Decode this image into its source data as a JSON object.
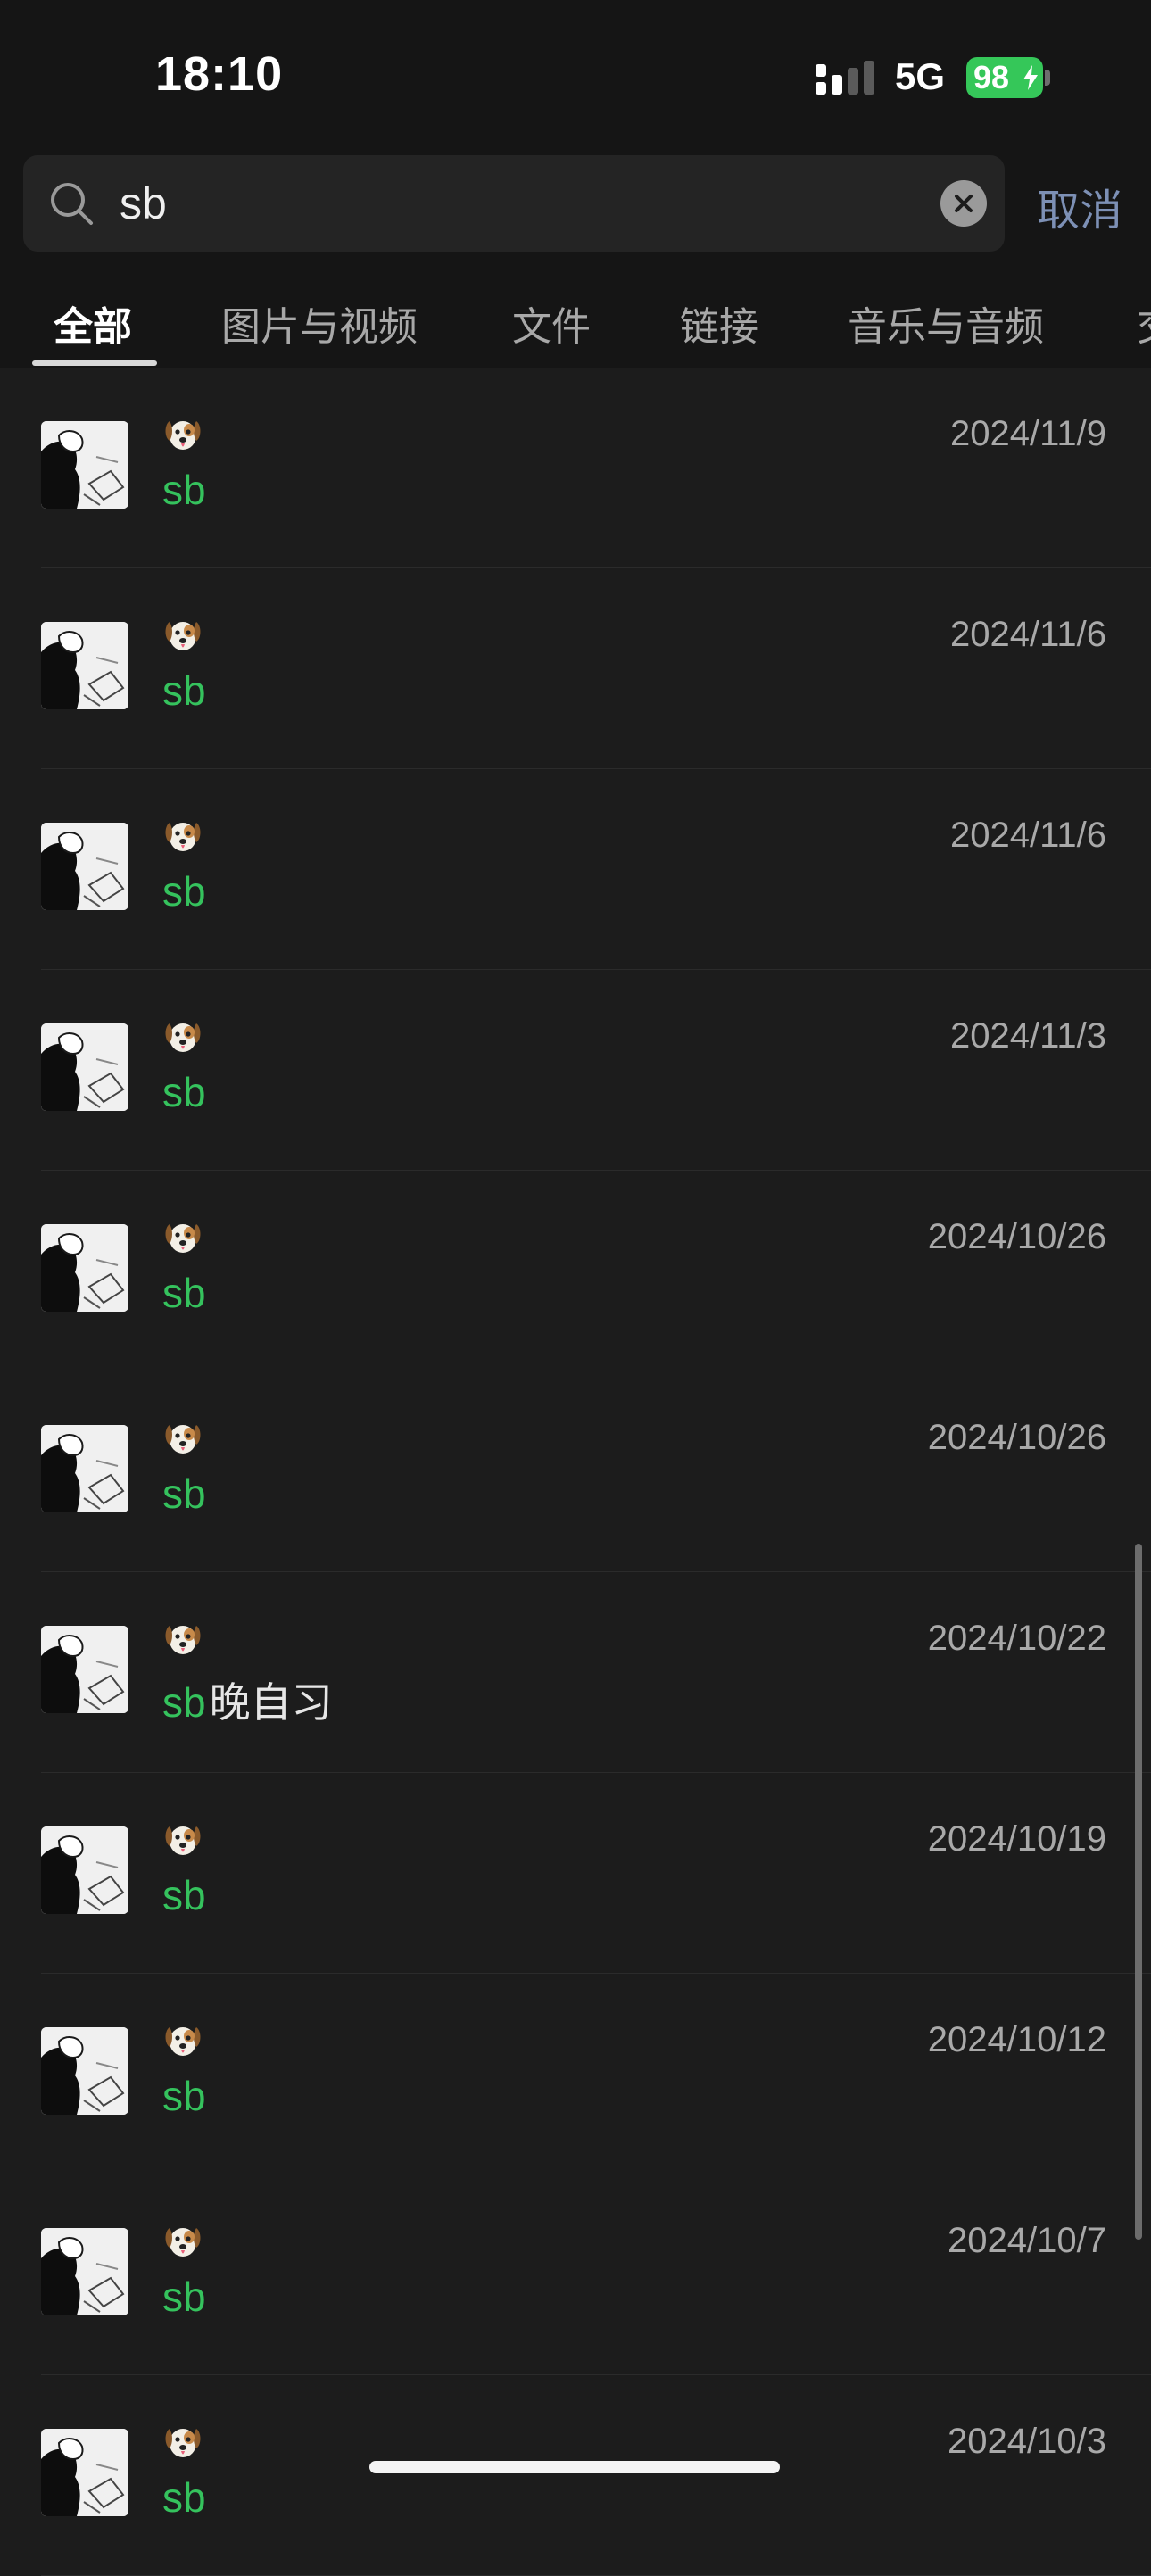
{
  "status_bar": {
    "time": "18:10",
    "network": "5G",
    "battery": "98"
  },
  "search": {
    "query": "sb",
    "placeholder": "",
    "cancel_label": "取消"
  },
  "tabs": [
    {
      "label": "全部",
      "active": true
    },
    {
      "label": "图片与视频",
      "active": false
    },
    {
      "label": "文件",
      "active": false
    },
    {
      "label": "链接",
      "active": false
    },
    {
      "label": "音乐与音频",
      "active": false
    },
    {
      "label": "交",
      "active": false
    }
  ],
  "results": [
    {
      "sender": "dog-face-emoji",
      "highlight": "sb",
      "rest": "",
      "date": "2024/11/9"
    },
    {
      "sender": "dog-face-emoji",
      "highlight": "sb",
      "rest": "",
      "date": "2024/11/6"
    },
    {
      "sender": "dog-face-emoji",
      "highlight": "sb",
      "rest": "",
      "date": "2024/11/6"
    },
    {
      "sender": "dog-face-emoji",
      "highlight": "sb",
      "rest": "",
      "date": "2024/11/3"
    },
    {
      "sender": "dog-face-emoji",
      "highlight": "sb",
      "rest": "",
      "date": "2024/10/26"
    },
    {
      "sender": "dog-face-emoji",
      "highlight": "sb",
      "rest": "",
      "date": "2024/10/26"
    },
    {
      "sender": "dog-face-emoji",
      "highlight": "sb",
      "rest": "晚自习",
      "date": "2024/10/22"
    },
    {
      "sender": "dog-face-emoji",
      "highlight": "sb",
      "rest": "",
      "date": "2024/10/19"
    },
    {
      "sender": "dog-face-emoji",
      "highlight": "sb",
      "rest": "",
      "date": "2024/10/12"
    },
    {
      "sender": "dog-face-emoji",
      "highlight": "sb",
      "rest": "",
      "date": "2024/10/7"
    },
    {
      "sender": "dog-face-emoji",
      "highlight": "sb",
      "rest": "",
      "date": "2024/10/3"
    }
  ],
  "colors": {
    "background": "#1c1c1c",
    "highlight": "#35c25d",
    "cancel": "#7d90b5",
    "battery": "#35c759"
  }
}
